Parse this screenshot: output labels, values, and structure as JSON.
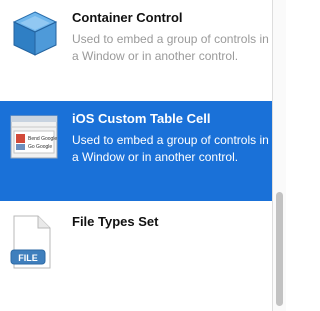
{
  "items": [
    {
      "title": "Container Control",
      "description": "Used to embed a group of controls in a Window or in another control.",
      "icon": "blue-cube-icon",
      "selected": false
    },
    {
      "title": "iOS Custom Table Cell",
      "description": "Used to embed a group of controls in a Window or in another control.",
      "icon": "table-cell-icon",
      "icon_text": [
        "Bend Google",
        "Go Google"
      ],
      "selected": true
    },
    {
      "title": "File Types Set",
      "description": "",
      "icon": "file-document-icon",
      "icon_text": "FILE",
      "selected": false
    }
  ],
  "colors": {
    "selection": "#1a71d8",
    "title": "#111111",
    "description": "#9a9a9a"
  }
}
